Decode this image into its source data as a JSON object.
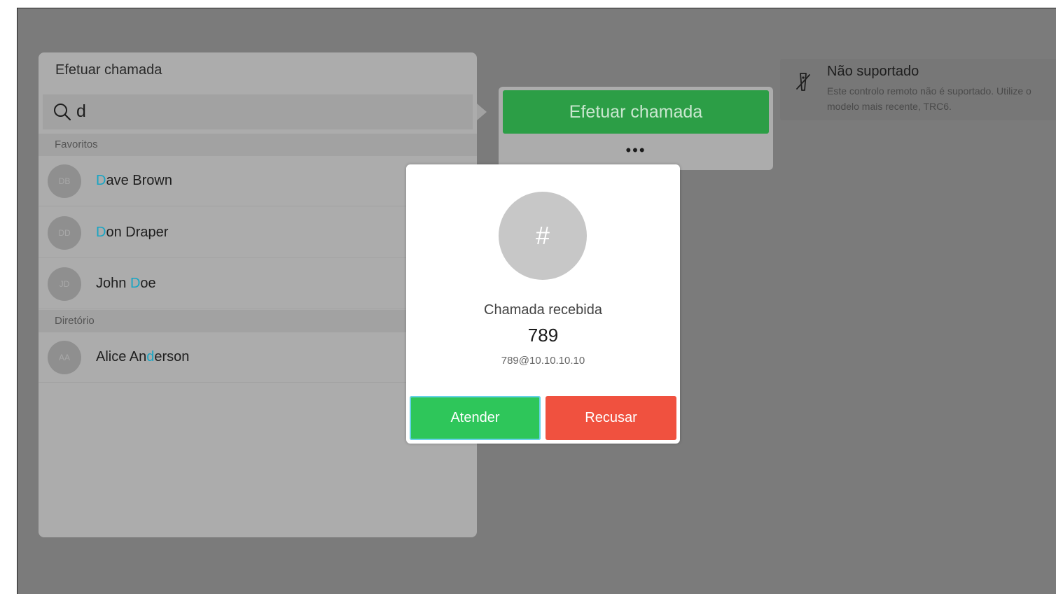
{
  "call_panel": {
    "title": "Efetuar chamada",
    "search": {
      "query": "d",
      "icon": "search-icon"
    },
    "sections": [
      {
        "header": "Favoritos",
        "contacts": [
          {
            "initials": "DB",
            "name_parts": [
              "",
              "D",
              "ave Brown"
            ]
          },
          {
            "initials": "DD",
            "name_parts": [
              "",
              "D",
              "on Draper"
            ]
          },
          {
            "initials": "JD",
            "name_parts": [
              "John ",
              "D",
              "oe"
            ]
          }
        ]
      },
      {
        "header": "Diretório",
        "contacts": [
          {
            "initials": "AA",
            "name_parts": [
              "Alice An",
              "d",
              "erson"
            ]
          }
        ]
      }
    ],
    "highlight_color": "#18a5c4"
  },
  "action_panel": {
    "call_button_label": "Efetuar chamada",
    "more_label": "•••",
    "call_button_color": "#2c9e46"
  },
  "notice": {
    "icon": "remote-not-supported-icon",
    "title": "Não suportado",
    "text": "Este controlo remoto não é suportado. Utilize o modelo mais recente, TRC6."
  },
  "incoming_call": {
    "avatar_symbol": "#",
    "label": "Chamada recebida",
    "number": "789",
    "uri": "789@10.10.10.10",
    "answer_label": "Atender",
    "decline_label": "Recusar",
    "answer_color": "#2ec65a",
    "decline_color": "#f0513f"
  }
}
